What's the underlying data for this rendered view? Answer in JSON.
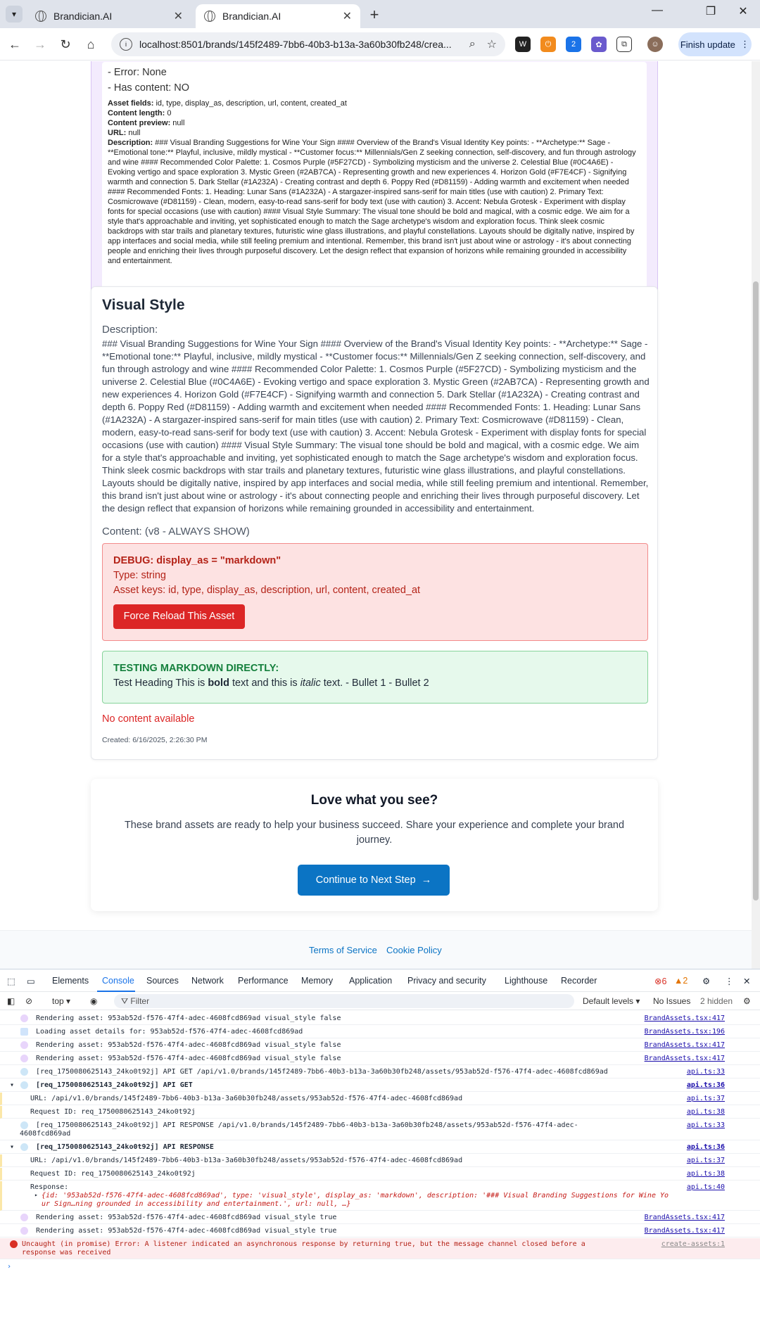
{
  "browser": {
    "tabs": [
      {
        "label": "Brandician.AI",
        "active": false
      },
      {
        "label": "Brandician.AI",
        "active": true
      }
    ],
    "url": "localhost:8501/brands/145f2489-7bb6-40b3-b13a-3a60b30fb248/crea...",
    "finish_label": "Finish update",
    "ext_badge": "2"
  },
  "debug_panel": {
    "error_line": "- Error: None",
    "has_content_line": "- Has content: NO",
    "asset_fields_label": "Asset fields:",
    "asset_fields_value": "id, type, display_as, description, url, content, created_at",
    "content_length_label": "Content length:",
    "content_length_value": "0",
    "content_preview_label": "Content preview:",
    "content_preview_value": "null",
    "url_label": "URL:",
    "url_value": "null",
    "description_label": "Description:",
    "description_value": "### Visual Branding Suggestions for Wine Your Sign #### Overview of the Brand's Visual Identity Key points: - **Archetype:** Sage - **Emotional tone:** Playful, inclusive, mildly mystical - **Customer focus:** Millennials/Gen Z seeking connection, self-discovery, and fun through astrology and wine #### Recommended Color Palette: 1. Cosmos Purple (#5F27CD) - Symbolizing mysticism and the universe 2. Celestial Blue (#0C4A6E) - Evoking vertigo and space exploration 3. Mystic Green (#2AB7CA) - Representing growth and new experiences 4. Horizon Gold (#F7E4CF) - Signifying warmth and connection 5. Dark Stellar (#1A232A) - Creating contrast and depth 6. Poppy Red (#D81159) - Adding warmth and excitement when needed #### Recommended Fonts: 1. Heading: Lunar Sans (#1A232A) - A stargazer-inspired sans-serif for main titles (use with caution) 2. Primary Text: Cosmicrowave (#D81159) - Clean, modern, easy-to-read sans-serif for body text (use with caution) 3. Accent: Nebula Grotesk - Experiment with display fonts for special occasions (use with caution) #### Visual Style Summary: The visual tone should be bold and magical, with a cosmic edge. We aim for a style that's approachable and inviting, yet sophisticated enough to match the Sage archetype's wisdom and exploration focus. Think sleek cosmic backdrops with star trails and planetary textures, futuristic wine glass illustrations, and playful constellations. Layouts should be digitally native, inspired by app interfaces and social media, while still feeling premium and intentional. Remember, this brand isn't just about wine or astrology - it's about connecting people and enriching their lives through purposeful discovery. Let the design reflect that expansion of horizons while remaining grounded in accessibility and entertainment."
  },
  "visual_style": {
    "title": "Visual Style",
    "description_label": "Description:",
    "description": "### Visual Branding Suggestions for Wine Your Sign #### Overview of the Brand's Visual Identity Key points: - **Archetype:** Sage - **Emotional tone:** Playful, inclusive, mildly mystical - **Customer focus:** Millennials/Gen Z seeking connection, self-discovery, and fun through astrology and wine #### Recommended Color Palette: 1. Cosmos Purple (#5F27CD) - Symbolizing mysticism and the universe 2. Celestial Blue (#0C4A6E) - Evoking vertigo and space exploration 3. Mystic Green (#2AB7CA) - Representing growth and new experiences 4. Horizon Gold (#F7E4CF) - Signifying warmth and connection 5. Dark Stellar (#1A232A) - Creating contrast and depth 6. Poppy Red (#D81159) - Adding warmth and excitement when needed #### Recommended Fonts: 1. Heading: Lunar Sans (#1A232A) - A stargazer-inspired sans-serif for main titles (use with caution) 2. Primary Text: Cosmicrowave (#D81159) - Clean, modern, easy-to-read sans-serif for body text (use with caution) 3. Accent: Nebula Grotesk - Experiment with display fonts for special occasions (use with caution) #### Visual Style Summary: The visual tone should be bold and magical, with a cosmic edge. We aim for a style that's approachable and inviting, yet sophisticated enough to match the Sage archetype's wisdom and exploration focus. Think sleek cosmic backdrops with star trails and planetary textures, futuristic wine glass illustrations, and playful constellations. Layouts should be digitally native, inspired by app interfaces and social media, while still feeling premium and intentional. Remember, this brand isn't just about wine or astrology - it's about connecting people and enriching their lives through purposeful discovery. Let the design reflect that expansion of horizons while remaining grounded in accessibility and entertainment.",
    "content_label": "Content: (v8 - ALWAYS SHOW)",
    "debug_title": "DEBUG: display_as = \"markdown\"",
    "debug_type": "Type: string",
    "debug_keys": "Asset keys: id, type, display_as, description, url, content, created_at",
    "reload_label": "Force Reload This Asset",
    "md_title": "TESTING MARKDOWN DIRECTLY:",
    "md_pre": "Test Heading This is ",
    "md_bold": "bold",
    "md_mid": " text and this is ",
    "md_italic": "italic",
    "md_post": " text. - Bullet 1 - Bullet 2",
    "no_content": "No content available",
    "created": "Created: 6/16/2025, 2:26:30 PM"
  },
  "cta": {
    "title": "Love what you see?",
    "text": "These brand assets are ready to help your business succeed. Share your experience and complete your brand journey.",
    "button": "Continue to Next Step"
  },
  "footer": {
    "terms": "Terms of Service",
    "cookie": "Cookie Policy"
  },
  "devtools": {
    "tabs": [
      "Elements",
      "Console",
      "Sources",
      "Network",
      "Performance",
      "Memory",
      "Application",
      "Privacy and security",
      "Lighthouse",
      "Recorder"
    ],
    "errors_count": "6",
    "warnings_count": "2",
    "context": "top",
    "filter_placeholder": "Filter",
    "levels": "Default levels",
    "issues": "No Issues",
    "hidden": "2 hidden",
    "console_lines": [
      {
        "type": "log",
        "text": "Rendering asset: 953ab52d-f576-47f4-adec-4608fcd869ad visual_style false",
        "src": "BrandAssets.tsx:417"
      },
      {
        "type": "log",
        "text": "Loading asset details for: 953ab52d-f576-47f4-adec-4608fcd869ad",
        "src": "BrandAssets.tsx:196"
      },
      {
        "type": "log",
        "text": "Rendering asset: 953ab52d-f576-47f4-adec-4608fcd869ad visual_style false",
        "src": "BrandAssets.tsx:417"
      },
      {
        "type": "log",
        "text": "Rendering asset: 953ab52d-f576-47f4-adec-4608fcd869ad visual_style false",
        "src": "BrandAssets.tsx:417"
      },
      {
        "type": "api",
        "text": "[req_1750080625143_24ko0t92j] API GET /api/v1.0/brands/145f2489-7bb6-40b3-b13a-3a60b30fb248/assets/953ab52d-f576-47f4-adec-4608fcd869ad",
        "src": "api.ts:33"
      },
      {
        "type": "group",
        "text": "[req_1750080625143_24ko0t92j] API GET",
        "src": "api.ts:36"
      },
      {
        "type": "indent",
        "text": "URL: /api/v1.0/brands/145f2489-7bb6-40b3-b13a-3a60b30fb248/assets/953ab52d-f576-47f4-adec-4608fcd869ad",
        "src": "api.ts:37"
      },
      {
        "type": "indent",
        "text": "Request ID: req_1750080625143_24ko0t92j",
        "src": "api.ts:38"
      },
      {
        "type": "api",
        "text": "[req_1750080625143_24ko0t92j] API RESPONSE /api/v1.0/brands/145f2489-7bb6-40b3-b13a-3a60b30fb248/assets/953ab52d-f576-47f4-adec-",
        "text2": "4608fcd869ad",
        "src": "api.ts:33"
      },
      {
        "type": "group",
        "text": "[req_1750080625143_24ko0t92j] API RESPONSE",
        "src": "api.ts:36"
      },
      {
        "type": "indent",
        "text": "URL: /api/v1.0/brands/145f2489-7bb6-40b3-b13a-3a60b30fb248/assets/953ab52d-f576-47f4-adec-4608fcd869ad",
        "src": "api.ts:37"
      },
      {
        "type": "indent",
        "text": "Request ID: req_1750080625143_24ko0t92j",
        "src": "api.ts:38"
      },
      {
        "type": "response",
        "text": "Response:",
        "obj": "{id: '953ab52d-f576-47f4-adec-4608fcd869ad', type: 'visual_style', display_as: 'markdown', description: '### Visual Branding Suggestions for Wine Yo",
        "obj2": "ur Sign…ning grounded in accessibility and entertainment.', url: null, …}",
        "src": "api.ts:40"
      },
      {
        "type": "log",
        "text": "Rendering asset: 953ab52d-f576-47f4-adec-4608fcd869ad visual_style true",
        "src": "BrandAssets.tsx:417"
      },
      {
        "type": "log",
        "text": "Rendering asset: 953ab52d-f576-47f4-adec-4608fcd869ad visual_style true",
        "src": "BrandAssets.tsx:417"
      },
      {
        "type": "error",
        "text": "Uncaught (in promise) Error: A listener indicated an asynchronous response by returning true, but the message channel closed before a",
        "text2": "response was received",
        "src": "create-assets:1"
      }
    ]
  },
  "colors": {
    "primary": "#0b74c4",
    "danger": "#dc2626",
    "success": "#15803d",
    "debug_bg": "#f3ebfd"
  }
}
